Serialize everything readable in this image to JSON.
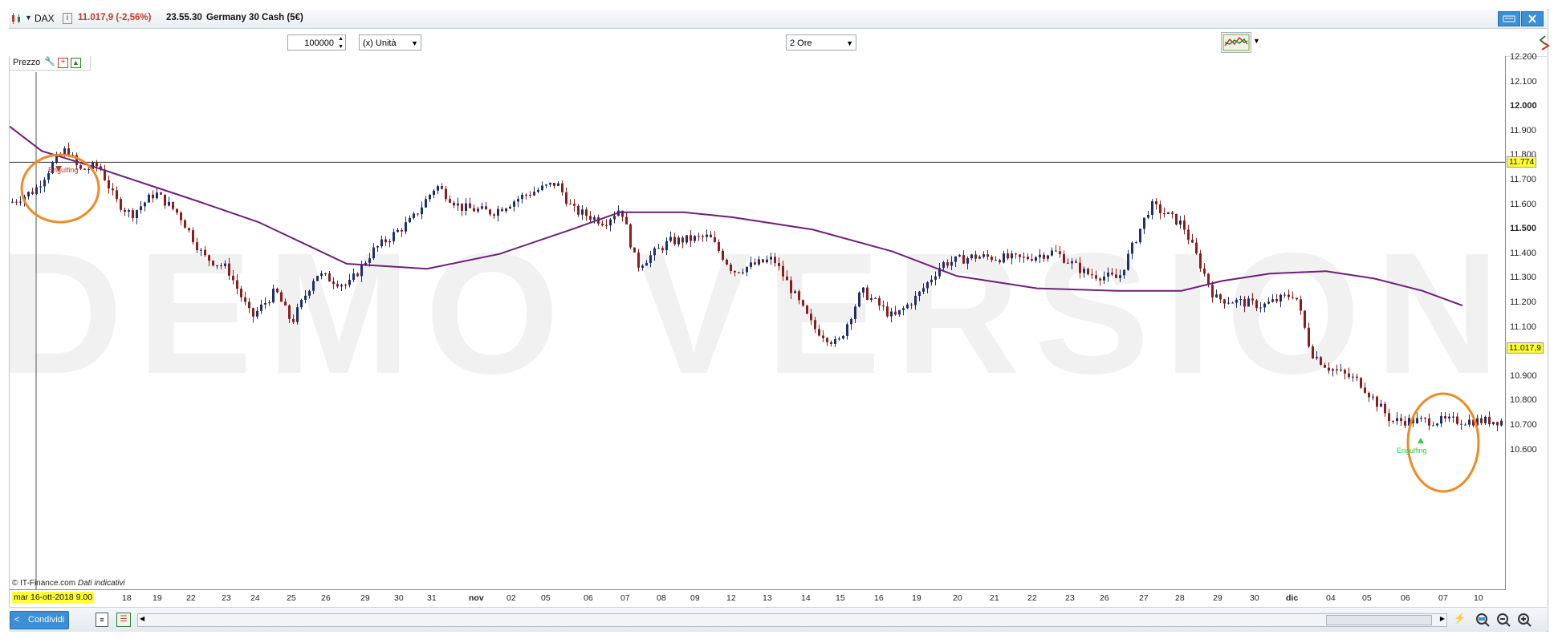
{
  "header": {
    "symbol": "DAX",
    "info_icon": "i",
    "price": "11.017,9 (-2,56%)",
    "time": "23.55.30",
    "instrument": "Germany 30 Cash (5€)"
  },
  "toolbar": {
    "quantity": "100000",
    "unit": "(x) Unità",
    "timeframe": "2 Ore"
  },
  "panel": {
    "title": "Prezzo"
  },
  "price_axis": {
    "labels": [
      "12.200",
      "12.100",
      "12.000",
      "11.900",
      "11.800",
      "11.700",
      "11.600",
      "11.500",
      "11.400",
      "11.300",
      "11.200",
      "11.100",
      "11.000",
      "10.900",
      "10.800",
      "10.700",
      "10.600"
    ],
    "bold_labels": [
      "12.000",
      "11.500",
      "11.000"
    ],
    "hline_badge": "11.774",
    "last_badge": "11.017,9"
  },
  "date_axis": {
    "cursor_date": "mar 16-ott-2018 9.00",
    "labels": [
      "18",
      "19",
      "22",
      "23",
      "24",
      "25",
      "26",
      "29",
      "30",
      "31",
      "nov",
      "02",
      "05",
      "06",
      "07",
      "08",
      "09",
      "12",
      "13",
      "14",
      "15",
      "16",
      "19",
      "20",
      "21",
      "22",
      "23",
      "26",
      "27",
      "28",
      "29",
      "30",
      "dic",
      "04",
      "05",
      "06",
      "07",
      "10"
    ],
    "bold_labels": [
      "nov",
      "dic"
    ]
  },
  "watermark": "DEMO VERSION",
  "annotations": {
    "engulfing_bear": "Engulfing",
    "engulfing_bull": "Engulfing"
  },
  "credits": {
    "source": "© IT-Finance.com",
    "note": "Dati indicativi"
  },
  "bottombar": {
    "share_label": "Condividi"
  },
  "colors": {
    "bull": "#1f2f6b",
    "bear": "#8b1d1d",
    "ma": "#6f1f78",
    "circle": "#f08a24",
    "badge": "#ffff33",
    "accent": "#3b8fd6"
  },
  "chart_data": {
    "type": "candlestick",
    "timeframe": "2 Ore",
    "ylim": [
      10550,
      12250
    ],
    "horizontal_line": 11774,
    "last": 11017.9,
    "moving_average": [
      [
        0,
        11920
      ],
      [
        40,
        11820
      ],
      [
        110,
        11750
      ],
      [
        230,
        11620
      ],
      [
        310,
        11530
      ],
      [
        420,
        11360
      ],
      [
        520,
        11340
      ],
      [
        610,
        11400
      ],
      [
        700,
        11500
      ],
      [
        760,
        11570
      ],
      [
        840,
        11570
      ],
      [
        900,
        11550
      ],
      [
        1000,
        11500
      ],
      [
        1100,
        11410
      ],
      [
        1180,
        11310
      ],
      [
        1280,
        11260
      ],
      [
        1380,
        11250
      ],
      [
        1460,
        11250
      ],
      [
        1510,
        11290
      ],
      [
        1570,
        11320
      ],
      [
        1640,
        11330
      ],
      [
        1700,
        11300
      ],
      [
        1760,
        11250
      ],
      [
        1810,
        11190
      ]
    ],
    "price_path": [
      [
        0,
        11610
      ],
      [
        30,
        11660
      ],
      [
        55,
        11780
      ],
      [
        70,
        11830
      ],
      [
        85,
        11740
      ],
      [
        110,
        11760
      ],
      [
        130,
        11620
      ],
      [
        150,
        11560
      ],
      [
        180,
        11650
      ],
      [
        210,
        11560
      ],
      [
        240,
        11390
      ],
      [
        270,
        11340
      ],
      [
        300,
        11140
      ],
      [
        330,
        11250
      ],
      [
        350,
        11120
      ],
      [
        380,
        11320
      ],
      [
        420,
        11270
      ],
      [
        450,
        11410
      ],
      [
        500,
        11540
      ],
      [
        530,
        11680
      ],
      [
        560,
        11590
      ],
      [
        600,
        11570
      ],
      [
        640,
        11640
      ],
      [
        680,
        11690
      ],
      [
        700,
        11580
      ],
      [
        740,
        11530
      ],
      [
        760,
        11590
      ],
      [
        780,
        11350
      ],
      [
        820,
        11450
      ],
      [
        870,
        11470
      ],
      [
        900,
        11330
      ],
      [
        950,
        11380
      ],
      [
        1000,
        11100
      ],
      [
        1030,
        11030
      ],
      [
        1060,
        11250
      ],
      [
        1100,
        11140
      ],
      [
        1130,
        11230
      ],
      [
        1160,
        11360
      ],
      [
        1200,
        11390
      ],
      [
        1260,
        11380
      ],
      [
        1300,
        11410
      ],
      [
        1340,
        11320
      ],
      [
        1380,
        11300
      ],
      [
        1420,
        11600
      ],
      [
        1460,
        11520
      ],
      [
        1500,
        11220
      ],
      [
        1560,
        11190
      ],
      [
        1600,
        11240
      ],
      [
        1620,
        11000
      ],
      [
        1640,
        10940
      ],
      [
        1680,
        10880
      ],
      [
        1720,
        10720
      ],
      [
        1760,
        10720
      ]
    ]
  }
}
